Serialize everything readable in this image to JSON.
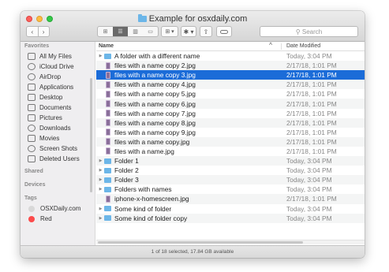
{
  "window": {
    "title": "Example for osxdaily.com",
    "status": "1 of 18 selected, 17.84 GB available"
  },
  "toolbar": {
    "back": "‹",
    "forward": "›",
    "views": [
      "⊞",
      "☰",
      "▥",
      "▭"
    ],
    "arrange": "⊞ ▾",
    "action": "✱ ▾",
    "share": "⇧",
    "search_placeholder": "Search",
    "search_icon": "magnifier-icon"
  },
  "sidebar": {
    "favorites_header": "Favorites",
    "favorites": [
      "All My Files",
      "iCloud Drive",
      "AirDrop",
      "Applications",
      "Desktop",
      "Documents",
      "Pictures",
      "Downloads",
      "Movies",
      "Screen Shots",
      "Deleted Users"
    ],
    "shared_header": "Shared",
    "devices_header": "Devices",
    "tags_header": "Tags",
    "tags": [
      {
        "label": "OSXDaily.com",
        "color": "#d8d8d8"
      },
      {
        "label": "Red",
        "color": "#fc4b4b"
      }
    ]
  },
  "columns": {
    "name": "Name",
    "sort_indicator": "^",
    "date": "Date Modified"
  },
  "files": [
    {
      "name": "A folder with a different name",
      "date": "Today, 3:04 PM",
      "kind": "folder"
    },
    {
      "name": "files with a name copy 2.jpg",
      "date": "2/17/18, 1:01 PM",
      "kind": "file"
    },
    {
      "name": "files with a name copy 3.jpg",
      "date": "2/17/18, 1:01 PM",
      "kind": "file",
      "selected": true
    },
    {
      "name": "files with a name copy 4.jpg",
      "date": "2/17/18, 1:01 PM",
      "kind": "file"
    },
    {
      "name": "files with a name copy 5.jpg",
      "date": "2/17/18, 1:01 PM",
      "kind": "file"
    },
    {
      "name": "files with a name copy 6.jpg",
      "date": "2/17/18, 1:01 PM",
      "kind": "file"
    },
    {
      "name": "files with a name copy 7.jpg",
      "date": "2/17/18, 1:01 PM",
      "kind": "file"
    },
    {
      "name": "files with a name copy 8.jpg",
      "date": "2/17/18, 1:01 PM",
      "kind": "file"
    },
    {
      "name": "files with a name copy 9.jpg",
      "date": "2/17/18, 1:01 PM",
      "kind": "file"
    },
    {
      "name": "files with a name copy.jpg",
      "date": "2/17/18, 1:01 PM",
      "kind": "file"
    },
    {
      "name": "files with a name.jpg",
      "date": "2/17/18, 1:01 PM",
      "kind": "file"
    },
    {
      "name": "Folder 1",
      "date": "Today, 3:04 PM",
      "kind": "folder"
    },
    {
      "name": "Folder 2",
      "date": "Today, 3:04 PM",
      "kind": "folder"
    },
    {
      "name": "Folder 3",
      "date": "Today, 3:04 PM",
      "kind": "folder"
    },
    {
      "name": "Folders with names",
      "date": "Today, 3:04 PM",
      "kind": "folder"
    },
    {
      "name": "iphone-x-homescreen.jpg",
      "date": "2/17/18, 1:01 PM",
      "kind": "file"
    },
    {
      "name": "Some kind of folder",
      "date": "Today, 3:04 PM",
      "kind": "folder"
    },
    {
      "name": "Some kind of folder copy",
      "date": "Today, 3:04 PM",
      "kind": "folder"
    }
  ],
  "colors": {
    "selection": "#1b6cd8",
    "folder": "#6cb6e8",
    "close": "#fc605c",
    "minimize": "#fdbc40",
    "maximize": "#34c84a"
  }
}
